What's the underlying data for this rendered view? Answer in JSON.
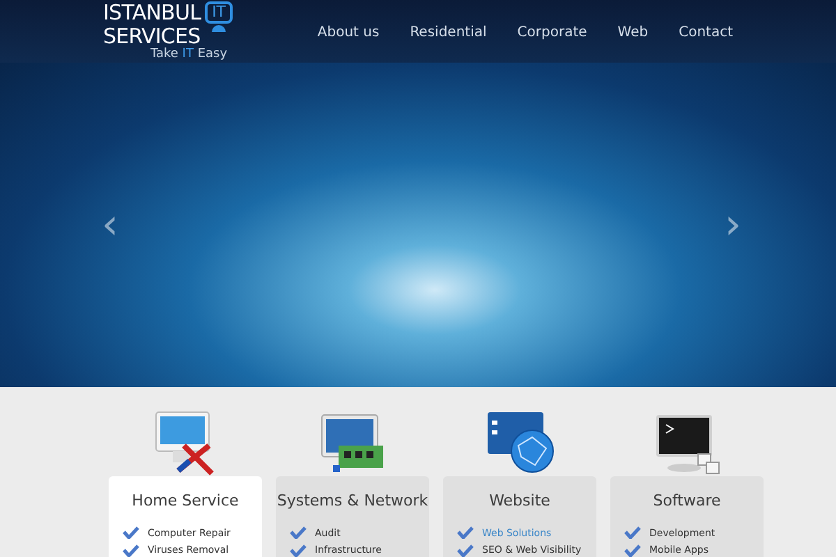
{
  "logo": {
    "line_1": "ISTANBUL",
    "line_2": "SERVICES",
    "badge": "IT",
    "tagline": [
      {
        "text": "Take ",
        "accent": false
      },
      {
        "text": "IT",
        "accent": true
      },
      {
        "text": " Easy",
        "accent": false
      }
    ]
  },
  "nav": [
    {
      "label": "About us"
    },
    {
      "label": "Residential"
    },
    {
      "label": "Corporate"
    },
    {
      "label": "Web"
    },
    {
      "label": "Contact"
    }
  ],
  "slider": {
    "prev": "‹",
    "next": "›"
  },
  "services": [
    {
      "title": "Home Service",
      "kind": "repair",
      "selected": true,
      "items": [
        {
          "label": "Computer Repair",
          "highlighted": false
        },
        {
          "label": "Viruses Removal",
          "highlighted": false
        }
      ]
    },
    {
      "title": "Systems & Network",
      "kind": "network",
      "selected": false,
      "items": [
        {
          "label": "Audit",
          "highlighted": false
        },
        {
          "label": "Infrastructure",
          "highlighted": false
        }
      ]
    },
    {
      "title": "Website",
      "kind": "globe",
      "selected": false,
      "items": [
        {
          "label": "Web Solutions",
          "highlighted": true
        },
        {
          "label": "SEO & Web Visibility",
          "highlighted": false
        }
      ]
    },
    {
      "title": "Software",
      "kind": "terminal",
      "selected": false,
      "items": [
        {
          "label": "Development",
          "highlighted": false
        },
        {
          "label": "Mobile Apps",
          "highlighted": false
        }
      ]
    }
  ]
}
